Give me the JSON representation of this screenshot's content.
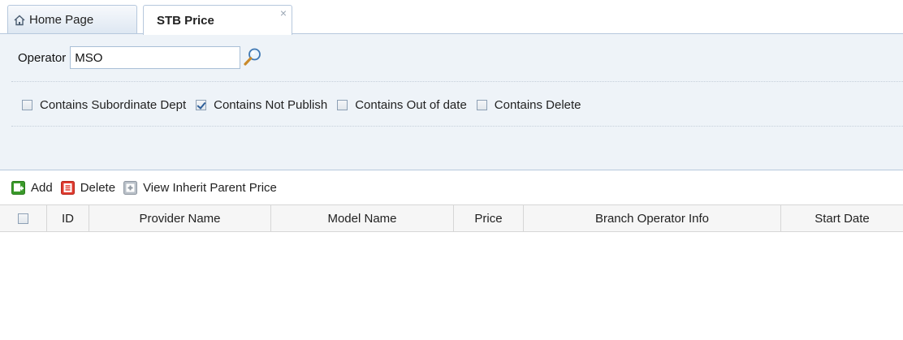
{
  "tabs": {
    "home_label": "Home Page",
    "active_label": "STB Price",
    "close_glyph": "×"
  },
  "filter": {
    "operator_label": "Operator",
    "operator_value": "MSO",
    "search_icon": "magnifier-icon",
    "options": [
      {
        "label": "Contains Subordinate Dept",
        "checked": false
      },
      {
        "label": "Contains Not Publish",
        "checked": true
      },
      {
        "label": "Contains Out of date",
        "checked": false
      },
      {
        "label": "Contains Delete",
        "checked": false
      }
    ]
  },
  "toolbar": {
    "add_label": "Add",
    "delete_label": "Delete",
    "inherit_label": "View Inherit Parent Price"
  },
  "grid": {
    "columns": [
      "ID",
      "Provider Name",
      "Model Name",
      "Price",
      "Branch Operator Info",
      "Start Date"
    ],
    "rows": []
  },
  "colors": {
    "panel_bg": "#eef3f8",
    "border": "#b6c8dd",
    "add_green": "#3a9a2a",
    "delete_red": "#e03a2e"
  }
}
